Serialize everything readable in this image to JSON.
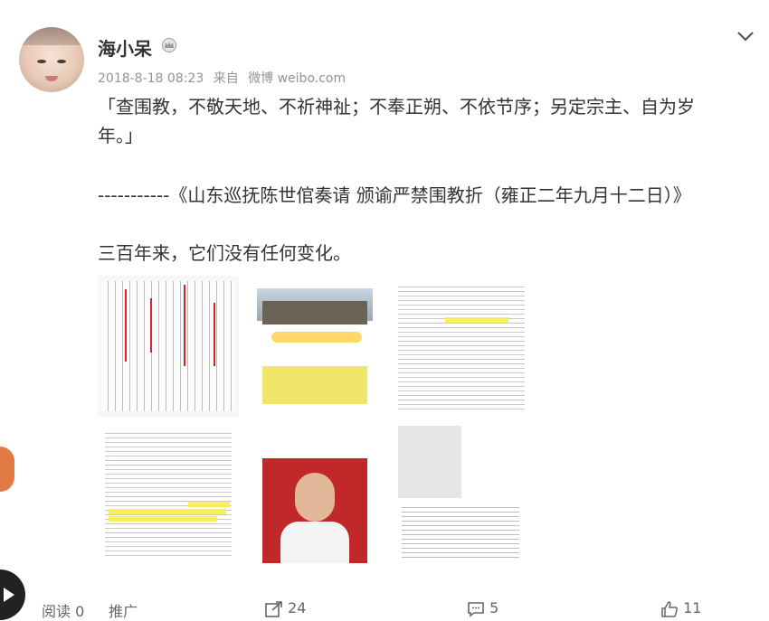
{
  "post": {
    "username": "海小呆",
    "time": "2018-8-18 08:23",
    "source_prefix": "来自",
    "source": "微博 weibo.com",
    "text": {
      "line1": "「查围教，不敬天地、不祈神祉；不奉正朔、不依节序；另定宗主、自为岁",
      "line2": "年。」",
      "line3": "-----------《山东巡抚陈世倌奏请 颁谕严禁围教折（雍正二年九月十二日）》",
      "line4": "三百年来，它们没有任何变化。"
    }
  },
  "footer": {
    "read_label": "阅读",
    "read_count": "0",
    "promote_label": "推广",
    "repost_count": "24",
    "comment_count": "5",
    "like_count": "11"
  },
  "icons": {
    "crown": "crown-badge-icon",
    "chevron": "chevron-down-icon",
    "repost": "repost-icon",
    "comment": "comment-icon",
    "like": "thumbs-up-icon"
  },
  "colors": {
    "username": "#333333",
    "meta": "#939393",
    "highlight": "#f7f04a",
    "red_mark": "#dd2222"
  }
}
